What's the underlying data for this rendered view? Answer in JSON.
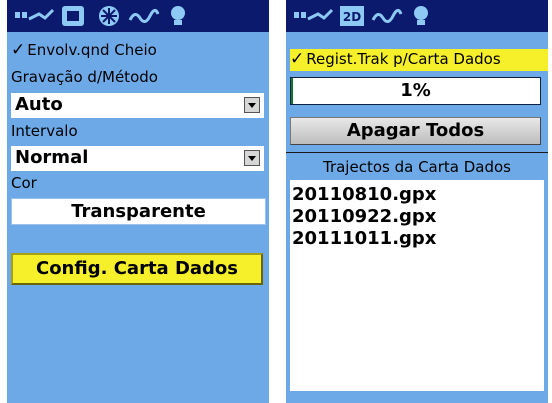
{
  "left": {
    "tabs": [
      "route-icon",
      "gps-icon",
      "satellite-icon",
      "track-icon",
      "lightbulb-icon"
    ],
    "wrap_checkbox": {
      "label": "Envolv.qnd Cheio",
      "checked": true
    },
    "method_label": "Gravação d/Método",
    "method_value": "Auto",
    "interval_label": "Intervalo",
    "interval_value": "Normal",
    "color_label": "Cor",
    "color_value": "Transparente",
    "config_button": "Config. Carta Dados"
  },
  "right": {
    "tabs": [
      "route-icon",
      "2d-icon",
      "track-icon",
      "lightbulb-icon"
    ],
    "record_checkbox": {
      "label": "Regist.Trak p/Carta Dados",
      "checked": true
    },
    "progress": {
      "text": "1%",
      "value": 0.01
    },
    "delete_button": "Apagar Todos",
    "section_title": "Trajectos da Carta Dados",
    "files": [
      "20110810.gpx",
      "20110922.gpx",
      "20111011.gpx"
    ]
  },
  "colors": {
    "background": "#6da9e7",
    "tabbar": "#0c1a6e",
    "highlight": "#f6f02a"
  }
}
